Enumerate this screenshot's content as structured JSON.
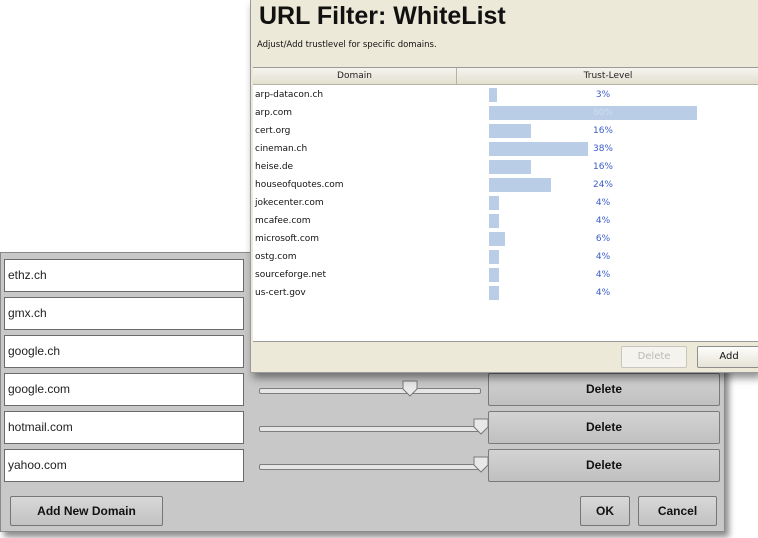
{
  "whitelist_dialog": {
    "title": "URL Filter: WhiteList",
    "subtitle": "Adjust/Add trustlevel for specific domains.",
    "columns": [
      "Domain",
      "Trust-Level"
    ],
    "rows": [
      {
        "domain": "arp-datacon.ch",
        "trust": "3%",
        "level": 0.03
      },
      {
        "domain": "arp.com",
        "trust": "80%",
        "level": 0.8
      },
      {
        "domain": "cert.org",
        "trust": "16%",
        "level": 0.16
      },
      {
        "domain": "cineman.ch",
        "trust": "38%",
        "level": 0.38
      },
      {
        "domain": "heise.de",
        "trust": "16%",
        "level": 0.16
      },
      {
        "domain": "houseofquotes.com",
        "trust": "24%",
        "level": 0.24
      },
      {
        "domain": "jokecenter.com",
        "trust": "4%",
        "level": 0.04
      },
      {
        "domain": "mcafee.com",
        "trust": "4%",
        "level": 0.04
      },
      {
        "domain": "microsoft.com",
        "trust": "6%",
        "level": 0.06
      },
      {
        "domain": "ostg.com",
        "trust": "4%",
        "level": 0.04
      },
      {
        "domain": "sourceforge.net",
        "trust": "4%",
        "level": 0.04
      },
      {
        "domain": "us-cert.gov",
        "trust": "4%",
        "level": 0.04
      }
    ],
    "delete_label": "Delete",
    "add_label": "Add",
    "bar_color": "#b9cde6",
    "pct_color": "#3a5dc8"
  },
  "domains_dialog": {
    "rows": [
      {
        "domain": "ethz.ch"
      },
      {
        "domain": "gmx.ch"
      },
      {
        "domain": "google.ch"
      },
      {
        "domain": "google.com",
        "level": 0.68,
        "delete_label": "Delete"
      },
      {
        "domain": "hotmail.com",
        "level": 1.0,
        "delete_label": "Delete"
      },
      {
        "domain": "yahoo.com",
        "level": 1.0,
        "delete_label": "Delete"
      }
    ],
    "add_new_label": "Add New Domain",
    "ok_label": "OK",
    "cancel_label": "Cancel"
  }
}
